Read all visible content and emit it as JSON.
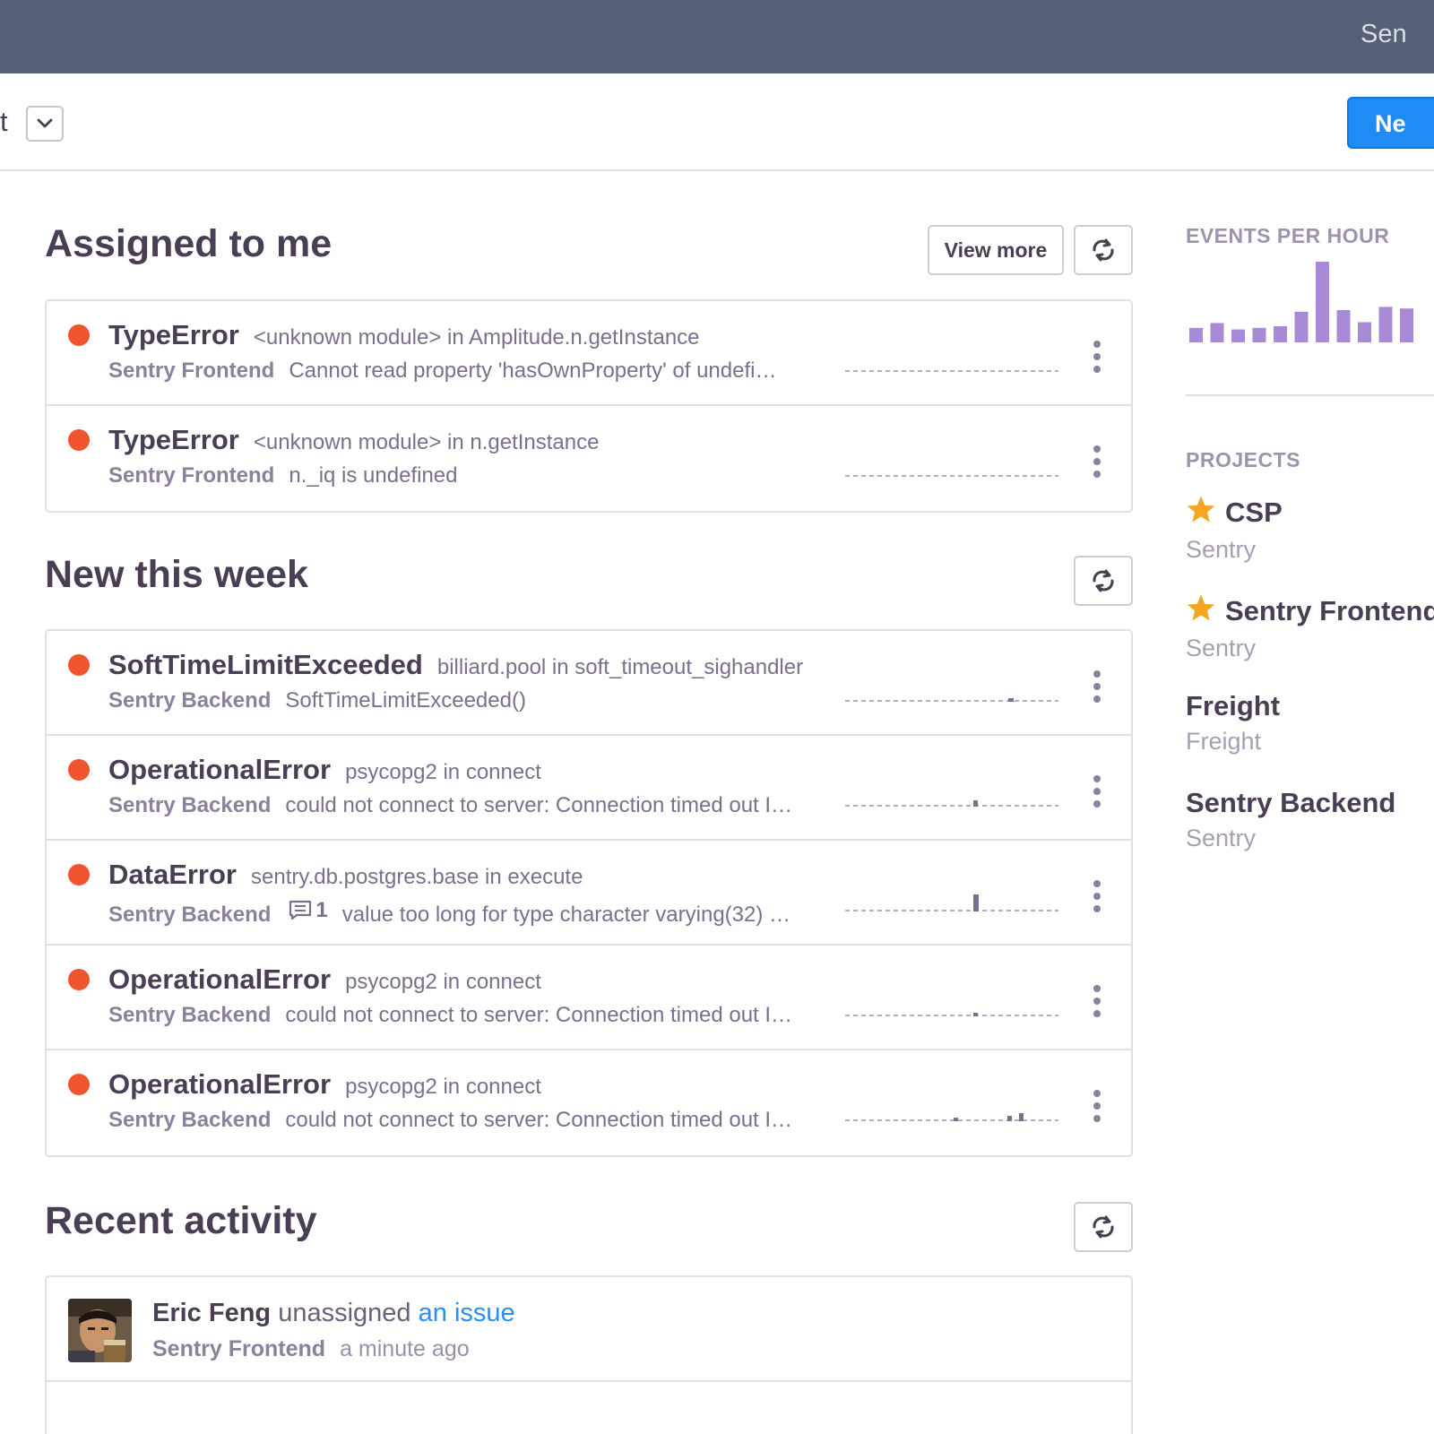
{
  "header": {
    "org_name_partial": "Sen"
  },
  "subbar": {
    "left_text_partial": "t",
    "new_button_label": "Ne"
  },
  "assigned": {
    "title": "Assigned to me",
    "view_more_label": "View more",
    "issues": [
      {
        "type": "TypeError",
        "culprit": "<unknown module> in Amplitude.n.getInstance",
        "project": "Sentry Frontend",
        "message": "Cannot read property 'hasOwnProperty' of undefi…",
        "comments": ""
      },
      {
        "type": "TypeError",
        "culprit": "<unknown module> in n.getInstance",
        "project": "Sentry Frontend",
        "message": "n._iq is undefined",
        "comments": ""
      }
    ]
  },
  "new_this_week": {
    "title": "New this week",
    "issues": [
      {
        "type": "SoftTimeLimitExceeded",
        "culprit": "billiard.pool in soft_timeout_sighandler",
        "project": "Sentry Backend",
        "message": "SoftTimeLimitExceeded()",
        "comments": ""
      },
      {
        "type": "OperationalError",
        "culprit": "psycopg2 in connect",
        "project": "Sentry Backend",
        "message": "could not connect to server: Connection timed out I…",
        "comments": ""
      },
      {
        "type": "DataError",
        "culprit": "sentry.db.postgres.base in execute",
        "project": "Sentry Backend",
        "message": "value too long for type character varying(32) …",
        "comments": "1"
      },
      {
        "type": "OperationalError",
        "culprit": "psycopg2 in connect",
        "project": "Sentry Backend",
        "message": "could not connect to server: Connection timed out I…",
        "comments": ""
      },
      {
        "type": "OperationalError",
        "culprit": "psycopg2 in connect",
        "project": "Sentry Backend",
        "message": "could not connect to server: Connection timed out I…",
        "comments": ""
      }
    ]
  },
  "recent_activity": {
    "title": "Recent activity",
    "items": [
      {
        "user": "Eric Feng",
        "verb": "unassigned",
        "link": "an issue",
        "project": "Sentry Frontend",
        "time": "a minute ago"
      }
    ]
  },
  "sidebar": {
    "events_heading": "EVENTS PER HOUR",
    "events_bars": [
      0.18,
      0.24,
      0.16,
      0.18,
      0.2,
      0.38,
      1.0,
      0.4,
      0.25,
      0.44,
      0.42
    ],
    "projects_heading": "PROJECTS",
    "projects": [
      {
        "name": "CSP",
        "org": "Sentry",
        "starred": true
      },
      {
        "name": "Sentry Frontend",
        "org": "Sentry",
        "starred": true
      },
      {
        "name": "Freight",
        "org": "Freight",
        "starred": false
      },
      {
        "name": "Sentry Backend",
        "org": "Sentry",
        "starred": false
      }
    ]
  },
  "colors": {
    "topbar": "#566077",
    "accent": "#1f8bf4",
    "error_dot": "#f0542f",
    "events_bar": "#a98ad6",
    "star": "#f4a623"
  }
}
